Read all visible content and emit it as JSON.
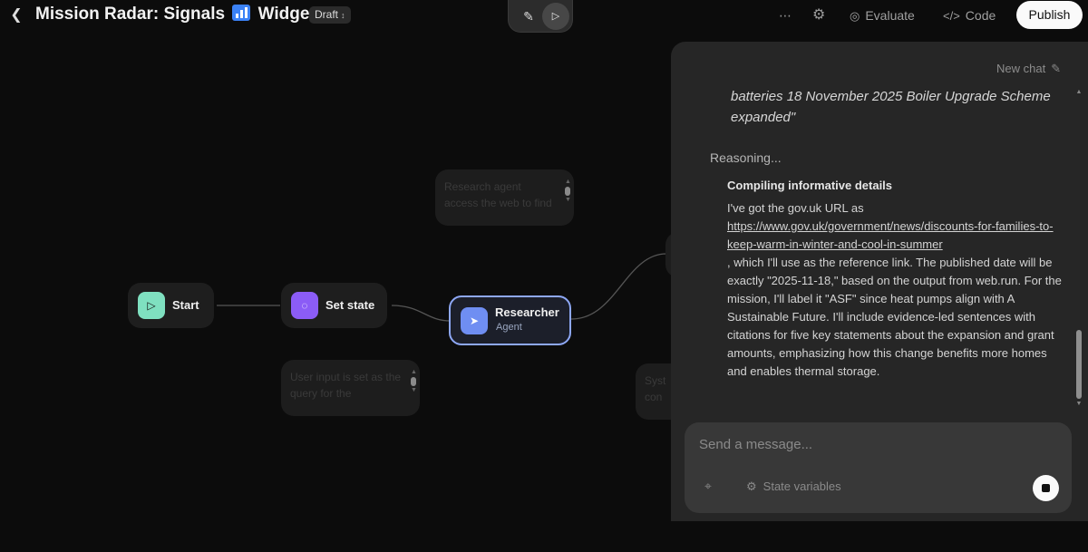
{
  "header": {
    "back_icon": "chevron-left-icon",
    "title_before": "Mission Radar: Signals",
    "title_emoji": "bar-chart-emoji",
    "title_after": "Widget",
    "status": "Draft",
    "more_icon": "ellipsis-icon",
    "settings_icon": "gear-icon",
    "evaluate_label": "Evaluate",
    "code_label": "Code",
    "publish_label": "Publish"
  },
  "mode_toggle": {
    "edit_icon": "pencil-icon",
    "preview_icon": "play-icon"
  },
  "canvas": {
    "nodes": {
      "start": {
        "label": "Start",
        "icon": "play-icon",
        "color": "#7fe0c0"
      },
      "set_state": {
        "label": "Set state",
        "icon": "dashed-circle-icon",
        "color": "#8b5cf6"
      },
      "researcher": {
        "label": "Researcher",
        "sublabel": "Agent",
        "icon": "cursor-icon",
        "color": "#6f8ef2",
        "selected_border": "#8ea8f5"
      }
    },
    "notes": {
      "researcher_note": "Research agent\naccess the web to find",
      "set_state_note": "User input is set as the\nquery for the",
      "right_note": "Syst\ncon"
    }
  },
  "chat": {
    "new_chat_label": "New chat",
    "quote_text": "batteries 18 November 2025 Boiler Upgrade Scheme expanded\"",
    "reasoning_label": "Reasoning...",
    "reasoning_title": "Compiling informative details",
    "reasoning_intro": "I've got the gov.uk URL as",
    "reasoning_link": "https://www.gov.uk/government/news/discounts-for-families-to-keep-warm-in-winter-and-cool-in-summer",
    "reasoning_rest": ", which I'll use as the reference link. The published date will be exactly \"2025-11-18,\" based on the output from web.run. For the mission, I'll label it \"ASF\" since heat pumps align with A Sustainable Future. I'll include evidence-led sentences with citations for five key statements about the expansion and grant amounts, emphasizing how this change benefits more homes and enables thermal storage.",
    "composer_placeholder": "Send a message...",
    "state_variables_label": "State variables"
  },
  "colors": {
    "background": "#0c0c0c",
    "panel": "#262626",
    "node": "#1e1e1e",
    "publish_bg": "#fafafa"
  }
}
